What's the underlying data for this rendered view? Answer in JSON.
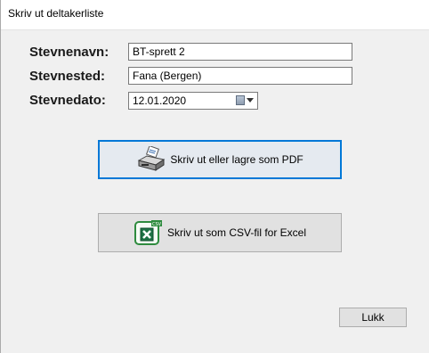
{
  "window": {
    "title": "Skriv ut deltakerliste"
  },
  "form": {
    "name_label": "Stevnenavn:",
    "name_value": "BT-sprett 2",
    "place_label": "Stevnested:",
    "place_value": "Fana (Bergen)",
    "date_label": "Stevnedato:",
    "date_value": "12.01.2020"
  },
  "buttons": {
    "pdf_label": "Skriv ut eller lagre som PDF",
    "csv_label": "Skriv ut som CSV-fil for Excel",
    "close_label": "Lukk"
  },
  "icons": {
    "pdf": "printer-icon",
    "csv": "excel-icon",
    "date": "calendar-icon"
  },
  "colors": {
    "focus_border": "#0078d7",
    "excel_green": "#1e7145"
  }
}
